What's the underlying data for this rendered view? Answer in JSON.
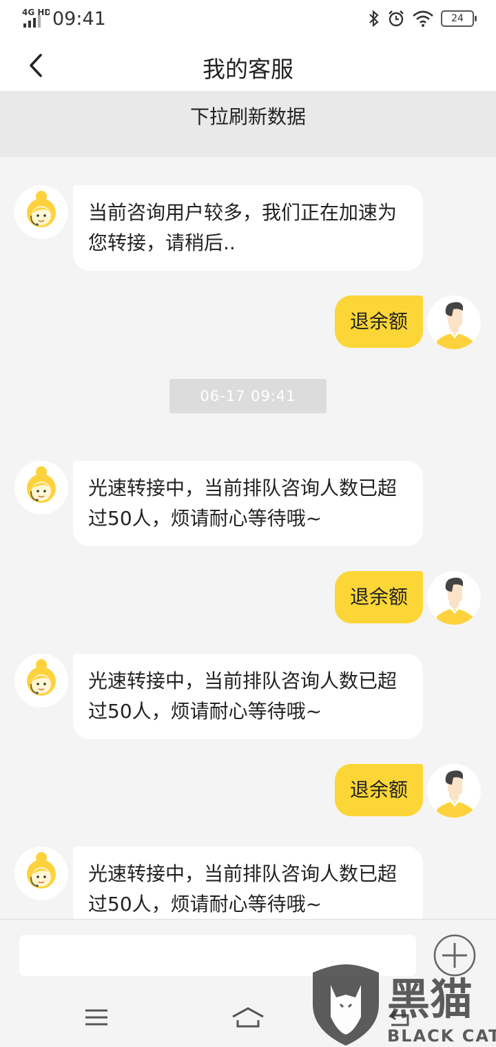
{
  "status_bar": {
    "network": "4G HD",
    "time": "09:41",
    "battery": "24"
  },
  "header": {
    "title": "我的客服"
  },
  "refresh_hint": "下拉刷新数据",
  "messages": [
    {
      "from": "agent",
      "text": "当前咨询用户较多，我们正在加速为您转接，请稍后.."
    },
    {
      "from": "user",
      "text": "退余额"
    },
    {
      "timestamp": "06-17 09:41"
    },
    {
      "from": "agent",
      "text": "光速转接中，当前排队咨询人数已超过50人，烦请耐心等待哦~"
    },
    {
      "from": "user",
      "text": "退余额"
    },
    {
      "from": "agent",
      "text": "光速转接中，当前排队咨询人数已超过50人，烦请耐心等待哦~"
    },
    {
      "from": "user",
      "text": "退余额"
    },
    {
      "from": "agent",
      "text": "光速转接中，当前排队咨询人数已超过50人，烦请耐心等待哦~"
    }
  ],
  "input": {
    "value": "",
    "placeholder": ""
  },
  "watermark": {
    "text": "黑猫",
    "subtext": "BLACK CAT"
  },
  "colors": {
    "accent": "#fbd636",
    "background": "#f4f4f4",
    "header_bg": "#ffffff"
  },
  "icons": {
    "back": "chevron-left-icon",
    "plus": "plus-circle-icon",
    "agent_avatar": "customer-service-agent-icon",
    "user_avatar": "user-avatar-icon",
    "nav_menu": "menu-icon",
    "nav_home": "home-icon",
    "nav_back": "back-icon"
  }
}
